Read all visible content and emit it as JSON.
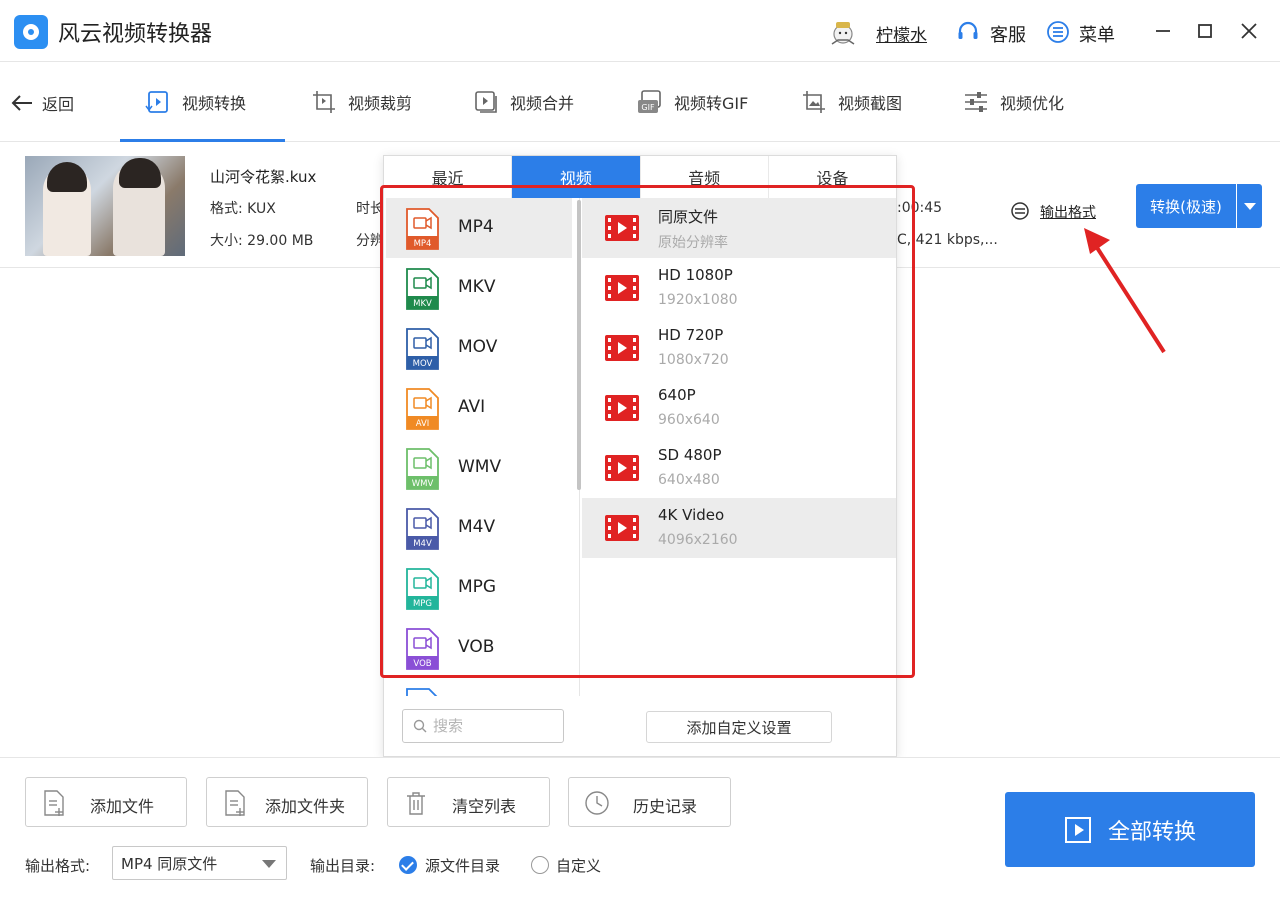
{
  "app": {
    "title": "风云视频转换器",
    "user_name": "柠檬水",
    "service_label": "客服",
    "menu_label": "菜单"
  },
  "nav": {
    "back_label": "返回",
    "tabs": [
      {
        "label": "视频转换",
        "icon": "video-convert-icon",
        "active": true
      },
      {
        "label": "视频裁剪",
        "icon": "video-crop-icon"
      },
      {
        "label": "视频合并",
        "icon": "video-merge-icon"
      },
      {
        "label": "视频转GIF",
        "icon": "gif-icon"
      },
      {
        "label": "视频截图",
        "icon": "screenshot-icon"
      },
      {
        "label": "视频优化",
        "icon": "optimize-icon"
      }
    ]
  },
  "file": {
    "name": "山河令花絮.kux",
    "format": "格式: KUX",
    "size": "大小: 29.00 MB",
    "duration_label": "时长",
    "resolution_label": "分辨",
    "duration_tail": ":00:45",
    "bitrate_tail": "C, 421 kbps,...",
    "output_format_link": "输出格式",
    "convert_button": "转换(极速)"
  },
  "popup": {
    "tabs": [
      "最近",
      "视频",
      "音频",
      "设备"
    ],
    "active_tab": "视频",
    "formats": [
      {
        "name": "MP4",
        "badge": "MP4",
        "color": "#e05a2b",
        "selected": true
      },
      {
        "name": "MKV",
        "badge": "MKV",
        "color": "#1f8a4c"
      },
      {
        "name": "MOV",
        "badge": "MOV",
        "color": "#2e5fa8"
      },
      {
        "name": "AVI",
        "badge": "AVI",
        "color": "#f08a24"
      },
      {
        "name": "WMV",
        "badge": "WMV",
        "color": "#6dbf6a"
      },
      {
        "name": "M4V",
        "badge": "M4V",
        "color": "#4a5aa8"
      },
      {
        "name": "MPG",
        "badge": "MPG",
        "color": "#23b59b"
      },
      {
        "name": "VOB",
        "badge": "VOB",
        "color": "#8a4fd6"
      }
    ],
    "resolutions": [
      {
        "title": "同原文件",
        "sub": "原始分辨率"
      },
      {
        "title": "HD 1080P",
        "sub": "1920x1080"
      },
      {
        "title": "HD 720P",
        "sub": "1080x720"
      },
      {
        "title": "640P",
        "sub": "960x640"
      },
      {
        "title": "SD 480P",
        "sub": "640x480"
      },
      {
        "title": "4K Video",
        "sub": "4096x2160"
      }
    ],
    "search_placeholder": "搜索",
    "custom_button": "添加自定义设置"
  },
  "bottom": {
    "add_file": "添加文件",
    "add_folder": "添加文件夹",
    "clear_list": "清空列表",
    "history": "历史记录",
    "output_format_label": "输出格式:",
    "output_format_value": "MP4 同原文件",
    "output_dir_label": "输出目录:",
    "source_dir_option": "源文件目录",
    "custom_option": "自定义",
    "convert_all": "全部转换"
  },
  "colors": {
    "accent": "#2c7ee8",
    "annotation": "#e02323"
  }
}
